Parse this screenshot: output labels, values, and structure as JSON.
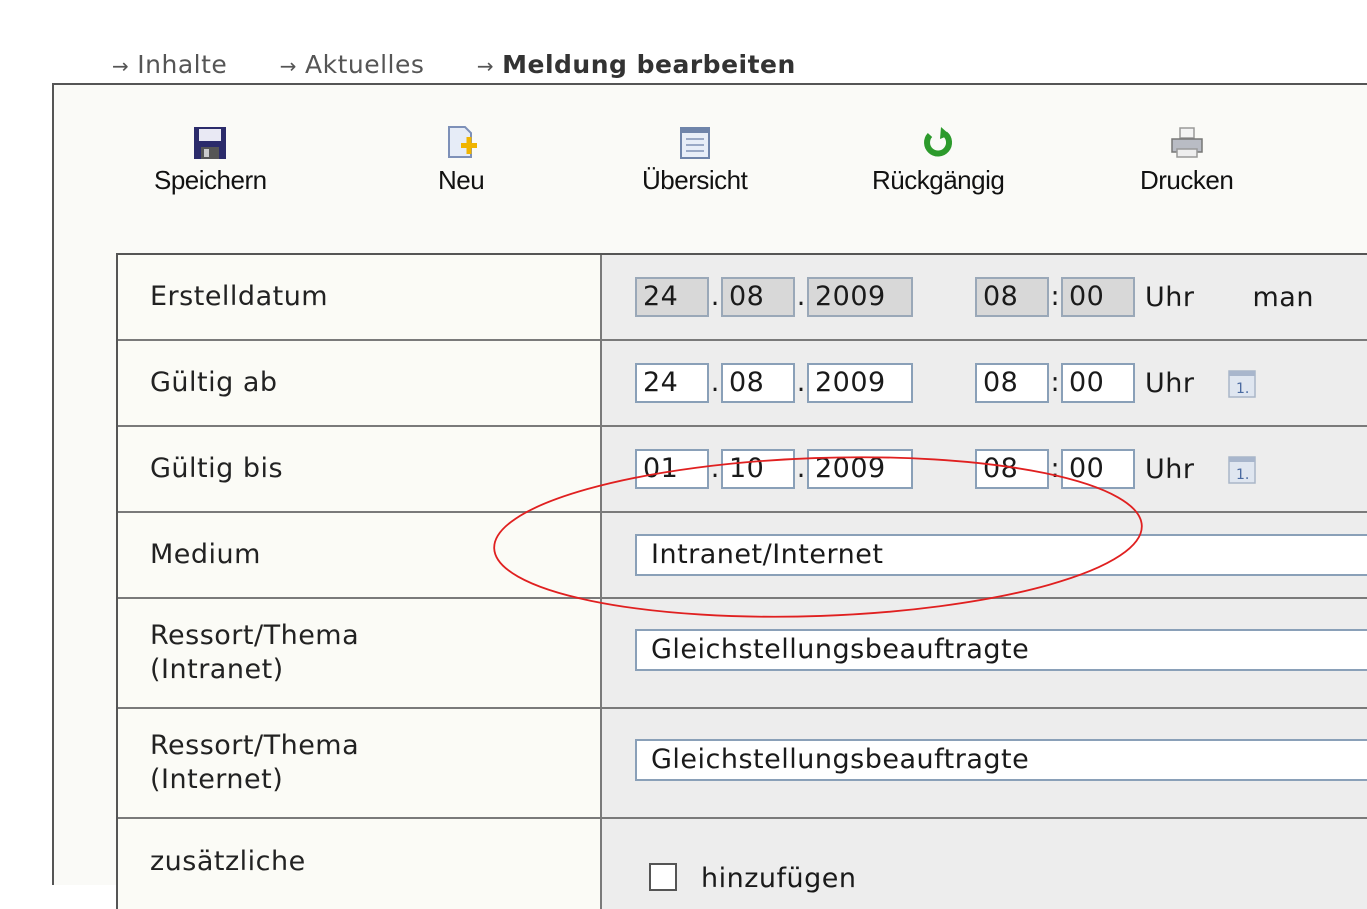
{
  "breadcrumb": [
    {
      "label": "Inhalte"
    },
    {
      "label": "Aktuelles"
    },
    {
      "label": "Meldung bearbeiten"
    }
  ],
  "toolbar": {
    "save": "Speichern",
    "new": "Neu",
    "overview": "Übersicht",
    "undo": "Rückgängig",
    "print": "Drucken"
  },
  "form": {
    "created": {
      "label": "Erstelldatum",
      "day": "24",
      "month": "08",
      "year": "2009",
      "hour": "08",
      "minute": "00",
      "unit": "Uhr",
      "extra": "man"
    },
    "valid_from": {
      "label": "Gültig ab",
      "day": "24",
      "month": "08",
      "year": "2009",
      "hour": "08",
      "minute": "00",
      "unit": "Uhr"
    },
    "valid_to": {
      "label": "Gültig bis",
      "day": "01",
      "month": "10",
      "year": "2009",
      "hour": "08",
      "minute": "00",
      "unit": "Uhr"
    },
    "medium": {
      "label": "Medium",
      "value": "Intranet/Internet"
    },
    "ressort_intranet": {
      "label_line1": "Ressort/Thema",
      "label_line2": "(Intranet)",
      "value": "Gleichstellungsbeauftragte"
    },
    "ressort_internet": {
      "label_line1": "Ressort/Thema",
      "label_line2": "(Internet)",
      "value": "Gleichstellungsbeauftragte"
    },
    "additional": {
      "label": "zusätzliche",
      "checkbox_label": "hinzufügen"
    }
  },
  "colors": {
    "annotation": "#e02020",
    "field_border": "#8aa0b8",
    "readonly_bg": "#d8d8d8"
  }
}
